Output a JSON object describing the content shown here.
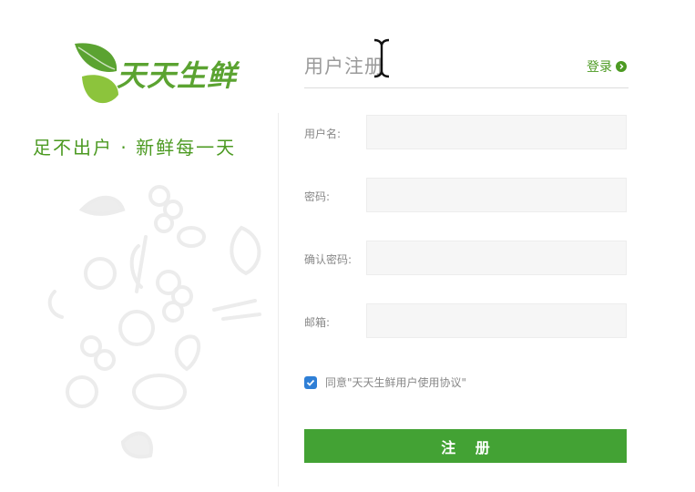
{
  "brand": {
    "name": "天天生鲜",
    "slogan": "足不出户 · 新鲜每一天"
  },
  "form": {
    "title": "用户注册",
    "login_link": "登录",
    "fields": [
      {
        "label": "用户名:",
        "value": "",
        "placeholder": ""
      },
      {
        "label": "密码:",
        "value": "",
        "placeholder": ""
      },
      {
        "label": "确认密码:",
        "value": "",
        "placeholder": ""
      },
      {
        "label": "邮箱:",
        "value": "",
        "placeholder": ""
      }
    ],
    "agree_checked": true,
    "agree_text": "同意\"天天生鲜用户使用协议\"",
    "submit_label": "注 册"
  },
  "colors": {
    "brand_green": "#4c9a22",
    "button_green": "#43a234",
    "checkbox_blue": "#2f7fd6"
  },
  "icons": {
    "login_arrow": "chevron-right-circle-icon",
    "cursor": "text-cursor-icon"
  }
}
